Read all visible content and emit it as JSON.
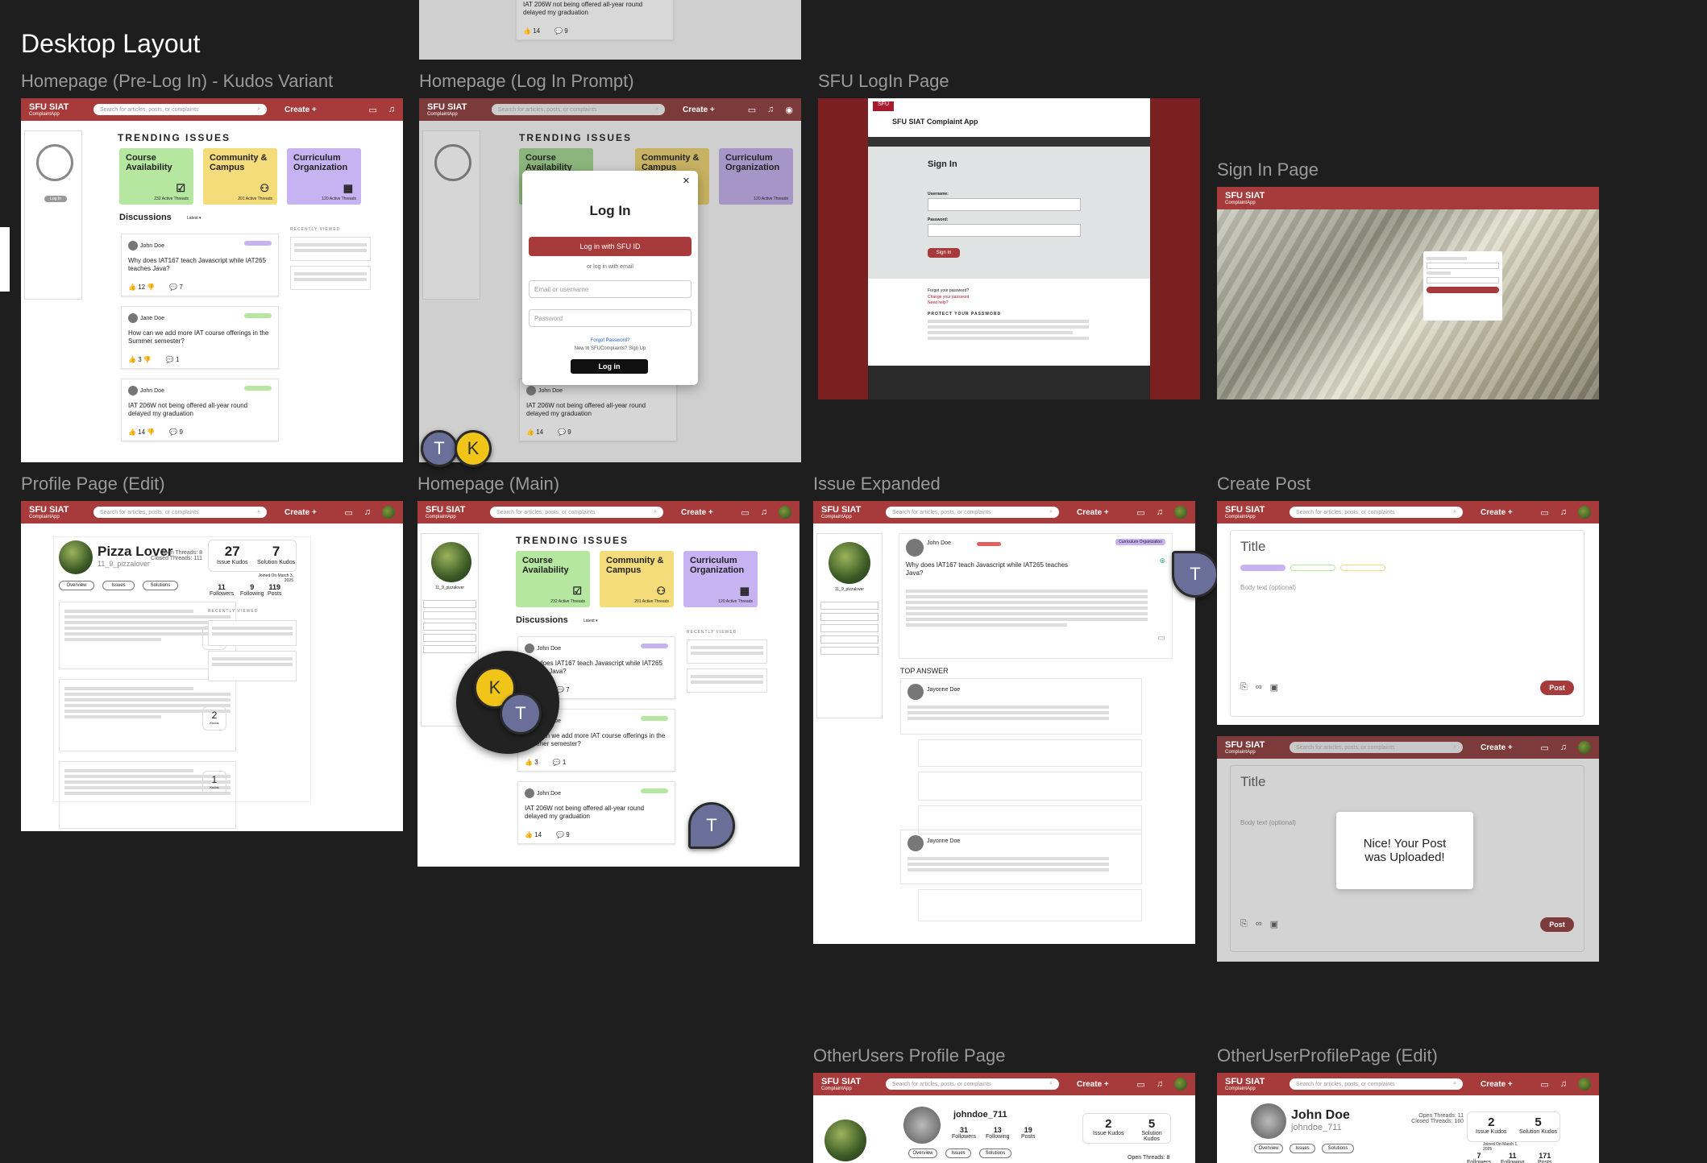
{
  "heading": "Desktop Layout",
  "frames": {
    "pre_login": "Homepage (Pre-Log In) - Kudos Variant",
    "login_prompt": "Homepage (Log In Prompt)",
    "sfu_login": "SFU LogIn Page",
    "sign_in": "Sign In Page",
    "profile_edit": "Profile Page (Edit)",
    "home_main": "Homepage (Main)",
    "issue_expanded": "Issue Expanded",
    "create_post": "Create Post",
    "other_profile": "OtherUsers Profile Page",
    "other_profile_edit": "OtherUserProfilePage (Edit)"
  },
  "nav": {
    "brand": "SFU SIAT",
    "brand_sub": "ComplaintApp",
    "search_placeholder": "Search for articles, posts, or complaints",
    "create": "Create +"
  },
  "trending": {
    "title": "TRENDING ISSUES",
    "cards": [
      {
        "title": "Course Availability",
        "count": "232 Active Threads",
        "color": "#b6e7a0"
      },
      {
        "title": "Community & Campus",
        "count": "201 Active Threads",
        "color": "#f4dc7a"
      },
      {
        "title": "Curriculum Organization",
        "count": "120 Active Threads",
        "color": "#c7b2f2"
      }
    ]
  },
  "discussions": {
    "title": "Discussions",
    "sort": "Latest",
    "posts": [
      {
        "author": "John Doe",
        "text": "Why does IAT167 teach Javascript while IAT265 teaches Java?",
        "likes": "12",
        "comments": "7"
      },
      {
        "author": "Jane Doe",
        "text": "How can we add more IAT course offerings in the Summer semester?",
        "likes": "3",
        "comments": "1"
      },
      {
        "author": "John Doe",
        "text": "IAT 206W not being offered all-year round delayed my graduation",
        "likes": "14",
        "comments": "9"
      }
    ]
  },
  "recently_viewed": "RECENTLY VIEWED",
  "login_button": "Log In",
  "login_modal": {
    "title": "Log In",
    "sfu_button": "Log in with SFU ID",
    "divider": "or log in with email",
    "email_placeholder": "Email or username",
    "password_placeholder": "Password",
    "forgot": "Forgot Password?",
    "new_user": "New to SFUComplaints? Sign Up",
    "submit": "Log in"
  },
  "sfu_login": {
    "header": "SFU SIAT Complaint App",
    "sign_in": "Sign In",
    "username": "Username:",
    "password": "Password:",
    "button": "Sign In",
    "forgot": "Forgot your password?",
    "change": "Change your password",
    "help": "Need help?",
    "protect": "PROTECT YOUR PASSWORD"
  },
  "profile": {
    "name": "Pizza Lover",
    "handle": "11_9_pizzalover",
    "open_threads": "Open Threads: 8",
    "closed_threads": "Closed Threads: 111",
    "joined": "Joined On March 3, 2025",
    "issue_kudos": "27",
    "solution_kudos": "7",
    "followers": "11",
    "following": "9",
    "posts": "119",
    "tabs": [
      "Overview",
      "Issues",
      "Solutions"
    ],
    "kudos": [
      "4",
      "2",
      "1"
    ]
  },
  "issue": {
    "title": "Why does IAT167 teach Javascript while IAT265 teaches Java?",
    "author": "John Doe",
    "top_answer": "TOP ANSWER",
    "answer_author": "Jayonne Doe",
    "tag": "Curriculum Organization"
  },
  "create_post": {
    "title_placeholder": "Title",
    "body_placeholder": "Body text (optional)",
    "post_button": "Post",
    "toast": "Nice! Your Post was Uploaded!"
  },
  "other_profile": {
    "handle": "johndoe_711",
    "followers": "31",
    "following": "13",
    "posts": "19",
    "issue_kudos": "2",
    "solution_kudos": "5",
    "open_threads": "Open Threads: 8"
  },
  "other_profile_edit": {
    "name": "John Doe",
    "handle": "johndoe_711",
    "open_threads": "Open Threads: 11",
    "closed_threads": "Closed Threads: 160",
    "issue_kudos": "2",
    "solution_kudos": "5",
    "joined": "Joined On March 1, 2025",
    "followers": "7",
    "following": "11",
    "posts": "171"
  },
  "cursors": {
    "t": "T",
    "k": "K"
  }
}
